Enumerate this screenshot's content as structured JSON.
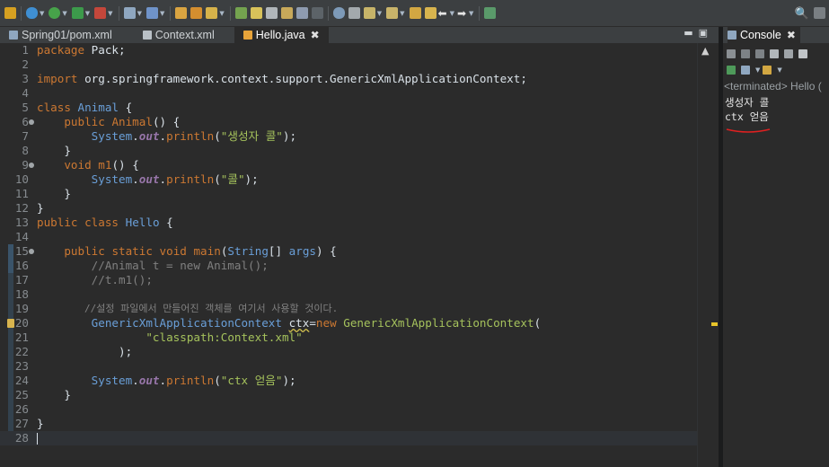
{
  "toolbar": {
    "icons": [
      "new-icon",
      "debug-icon",
      "run-icon",
      "run-last-icon",
      "external-tools-icon",
      "new-server-icon",
      "new-java-project-icon",
      "new-package-icon",
      "new-class-icon",
      "open-type-icon",
      "open-task-icon",
      "search-icon",
      "toggle-ant-icon",
      "mark-occurrences-icon",
      "next-annotation-icon",
      "prev-annotation-icon",
      "back-icon",
      "forward-icon",
      "pin-editor-icon",
      "perspective-icon"
    ]
  },
  "editor": {
    "tabs": [
      {
        "label": "Spring01/pom.xml",
        "icon": "xml-file-icon",
        "active": false
      },
      {
        "label": "Context.xml",
        "icon": "xml-file-icon",
        "active": false
      },
      {
        "label": "Hello.java",
        "icon": "java-file-icon",
        "active": true,
        "close": "✖"
      }
    ],
    "controls": {
      "minimize": "▬",
      "maximize": "▣"
    },
    "lines": [
      {
        "n": "1",
        "code": "package Pack;"
      },
      {
        "n": "2",
        "code": ""
      },
      {
        "n": "3",
        "code": "import org.springframework.context.support.GenericXmlApplicationContext;"
      },
      {
        "n": "4",
        "code": ""
      },
      {
        "n": "5",
        "code": "class Animal {"
      },
      {
        "n": "6",
        "code": "    public Animal() {"
      },
      {
        "n": "7",
        "code": "        System.out.println(\"생성자 콜\");"
      },
      {
        "n": "8",
        "code": "    }"
      },
      {
        "n": "9",
        "code": "    void m1() {"
      },
      {
        "n": "10",
        "code": "        System.out.println(\"콜\");"
      },
      {
        "n": "11",
        "code": "    }"
      },
      {
        "n": "12",
        "code": "}"
      },
      {
        "n": "13",
        "code": "public class Hello {"
      },
      {
        "n": "14",
        "code": ""
      },
      {
        "n": "15",
        "code": "    public static void main(String[] args) {"
      },
      {
        "n": "16",
        "code": "        //Animal t = new Animal();"
      },
      {
        "n": "17",
        "code": "        //t.m1();"
      },
      {
        "n": "18",
        "code": ""
      },
      {
        "n": "19",
        "code": "        //설정 파일에서 만들어진 객체를 여기서 사용할 것이다."
      },
      {
        "n": "20",
        "code": "        GenericXmlApplicationContext ctx=new GenericXmlApplicationContext("
      },
      {
        "n": "21",
        "code": "                \"classpath:Context.xml\""
      },
      {
        "n": "22",
        "code": "            );"
      },
      {
        "n": "23",
        "code": ""
      },
      {
        "n": "24",
        "code": "        System.out.println(\"ctx 얻음\");"
      },
      {
        "n": "25",
        "code": "    }"
      },
      {
        "n": "26",
        "code": ""
      },
      {
        "n": "27",
        "code": "}"
      },
      {
        "n": "28",
        "code": ""
      }
    ],
    "scroll_up": "▲"
  },
  "console": {
    "tab_label": "Console",
    "close": "✖",
    "status": "<terminated> Hello (",
    "output": [
      "생성자 콜",
      "ctx 얻음"
    ],
    "annotation_color": "#e02020"
  },
  "colors": {
    "keyword": "#cc7832",
    "class": "#6a9fd8",
    "string": "#a5c25c",
    "comment": "#808080",
    "static_field": "#9876aa",
    "background": "#2b2b2b"
  }
}
